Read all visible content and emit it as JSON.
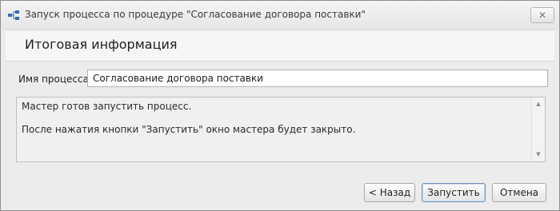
{
  "window": {
    "title": "Запуск процесса по процедуре \"Согласование договора поставки\"",
    "close_glyph": "✕",
    "icon": "process-flow-icon"
  },
  "header": {
    "title": "Итоговая информация"
  },
  "form": {
    "process_name_label": "Имя процесса:",
    "process_name_value": "Согласование договора поставки"
  },
  "summary": {
    "line1": "Мастер готов запустить процесс.",
    "line2": "После нажатия кнопки \"Запустить\" окно мастера будет закрыто.",
    "scroll_up_glyph": "▲",
    "scroll_down_glyph": "▼"
  },
  "buttons": {
    "back_label": "< Назад",
    "start_label": "Запустить",
    "cancel_label": "Отмена"
  },
  "colors": {
    "accent": "#2f6fb3",
    "window_bg": "#ececec",
    "header_bg": "#f6f6f6"
  }
}
